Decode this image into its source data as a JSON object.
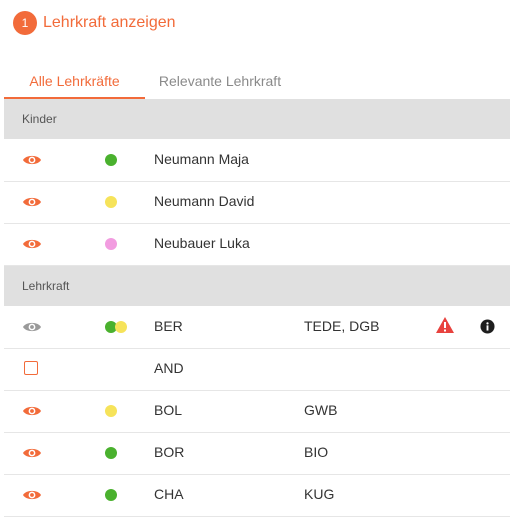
{
  "header": {
    "step_number": "1",
    "title": "Lehrkraft anzeigen"
  },
  "tabs": [
    {
      "label": "Alle Lehrkräfte",
      "active": true
    },
    {
      "label": "Relevante Lehrkraft",
      "active": false
    }
  ],
  "sections": {
    "kinder": {
      "title": "Kinder",
      "rows": [
        {
          "visibility": "visible",
          "dots": [
            "#4ab12e"
          ],
          "name": "Neumann Maja"
        },
        {
          "visibility": "visible",
          "dots": [
            "#f6e35a"
          ],
          "name": "Neumann David"
        },
        {
          "visibility": "visible",
          "dots": [
            "#f29ce0"
          ],
          "name": "Neubauer Luka"
        }
      ]
    },
    "lehrkraft": {
      "title": "Lehrkraft",
      "rows": [
        {
          "visibility": "hidden",
          "dots": [
            "#4ab12e",
            "#f6e35a"
          ],
          "name": "BER",
          "code": "TEDE, DGB",
          "warning": true,
          "info": true
        },
        {
          "visibility": "checkbox",
          "dots": [],
          "name": "AND",
          "code": ""
        },
        {
          "visibility": "visible",
          "dots": [
            "#f6e35a"
          ],
          "name": "BOL",
          "code": "GWB"
        },
        {
          "visibility": "visible",
          "dots": [
            "#4ab12e"
          ],
          "name": "BOR",
          "code": "BIO"
        },
        {
          "visibility": "visible",
          "dots": [
            "#4ab12e"
          ],
          "name": "CHA",
          "code": "KUG"
        }
      ]
    }
  },
  "colors": {
    "accent": "#f26b3a",
    "eye_inactive": "#9a9a9a",
    "warning": "#e8423e",
    "section_bg": "#e0e0e0"
  },
  "icons": {
    "visible": "eye-icon",
    "hidden": "eye-icon-inactive",
    "warning": "warning-icon",
    "info": "info-icon",
    "checkbox": "checkbox-icon"
  }
}
